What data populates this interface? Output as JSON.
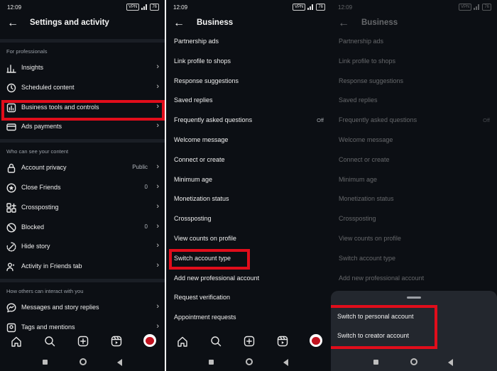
{
  "status": {
    "time": "12:09",
    "vpn": "VPN",
    "battery": "76"
  },
  "panel1": {
    "title": "Settings and activity",
    "sections": [
      {
        "heading": "For professionals",
        "items": [
          {
            "label": "Insights",
            "value": ""
          },
          {
            "label": "Scheduled content",
            "value": ""
          },
          {
            "label": "Business tools and controls",
            "value": ""
          },
          {
            "label": "Ads payments",
            "value": ""
          }
        ]
      },
      {
        "heading": "Who can see your content",
        "items": [
          {
            "label": "Account privacy",
            "value": "Public"
          },
          {
            "label": "Close Friends",
            "value": "0"
          },
          {
            "label": "Crossposting",
            "value": ""
          },
          {
            "label": "Blocked",
            "value": "0"
          },
          {
            "label": "Hide story",
            "value": ""
          },
          {
            "label": "Activity in Friends tab",
            "value": ""
          }
        ]
      },
      {
        "heading": "How others can interact with you",
        "items": [
          {
            "label": "Messages and story replies",
            "value": ""
          },
          {
            "label": "Tags and mentions",
            "value": ""
          }
        ]
      }
    ]
  },
  "panel2": {
    "title": "Business",
    "items": [
      {
        "label": "Partnership ads",
        "value": ""
      },
      {
        "label": "Link profile to shops",
        "value": ""
      },
      {
        "label": "Response suggestions",
        "value": ""
      },
      {
        "label": "Saved replies",
        "value": ""
      },
      {
        "label": "Frequently asked questions",
        "value": "Off"
      },
      {
        "label": "Welcome message",
        "value": ""
      },
      {
        "label": "Connect or create",
        "value": ""
      },
      {
        "label": "Minimum age",
        "value": ""
      },
      {
        "label": "Monetization status",
        "value": ""
      },
      {
        "label": "Crossposting",
        "value": ""
      },
      {
        "label": "View counts on profile",
        "value": ""
      },
      {
        "label": "Switch account type",
        "value": ""
      },
      {
        "label": "Add new professional account",
        "value": ""
      },
      {
        "label": "Request verification",
        "value": ""
      },
      {
        "label": "Appointment requests",
        "value": ""
      }
    ]
  },
  "panel3": {
    "title": "Business",
    "items": [
      {
        "label": "Partnership ads",
        "value": ""
      },
      {
        "label": "Link profile to shops",
        "value": ""
      },
      {
        "label": "Response suggestions",
        "value": ""
      },
      {
        "label": "Saved replies",
        "value": ""
      },
      {
        "label": "Frequently asked questions",
        "value": "Off"
      },
      {
        "label": "Welcome message",
        "value": ""
      },
      {
        "label": "Connect or create",
        "value": ""
      },
      {
        "label": "Minimum age",
        "value": ""
      },
      {
        "label": "Monetization status",
        "value": ""
      },
      {
        "label": "Crossposting",
        "value": ""
      },
      {
        "label": "View counts on profile",
        "value": ""
      },
      {
        "label": "Switch account type",
        "value": ""
      },
      {
        "label": "Add new professional account",
        "value": ""
      }
    ],
    "sheet_options": [
      "Switch to personal account",
      "Switch to creator account"
    ]
  },
  "colors": {
    "background": "#0c0f14",
    "highlight": "#e10d1b",
    "sheet": "#23272e"
  },
  "icons": {
    "panel1_items": [
      "insights-icon",
      "scheduled-content-icon",
      "business-tools-icon",
      "ads-payments-icon",
      "lock-icon",
      "close-friends-icon",
      "crossposting-icon",
      "blocked-icon",
      "hide-story-icon",
      "friends-activity-icon",
      "messages-icon",
      "tags-icon"
    ],
    "navbar": [
      "home-icon",
      "search-icon",
      "create-icon",
      "reels-icon",
      "profile-avatar"
    ]
  }
}
